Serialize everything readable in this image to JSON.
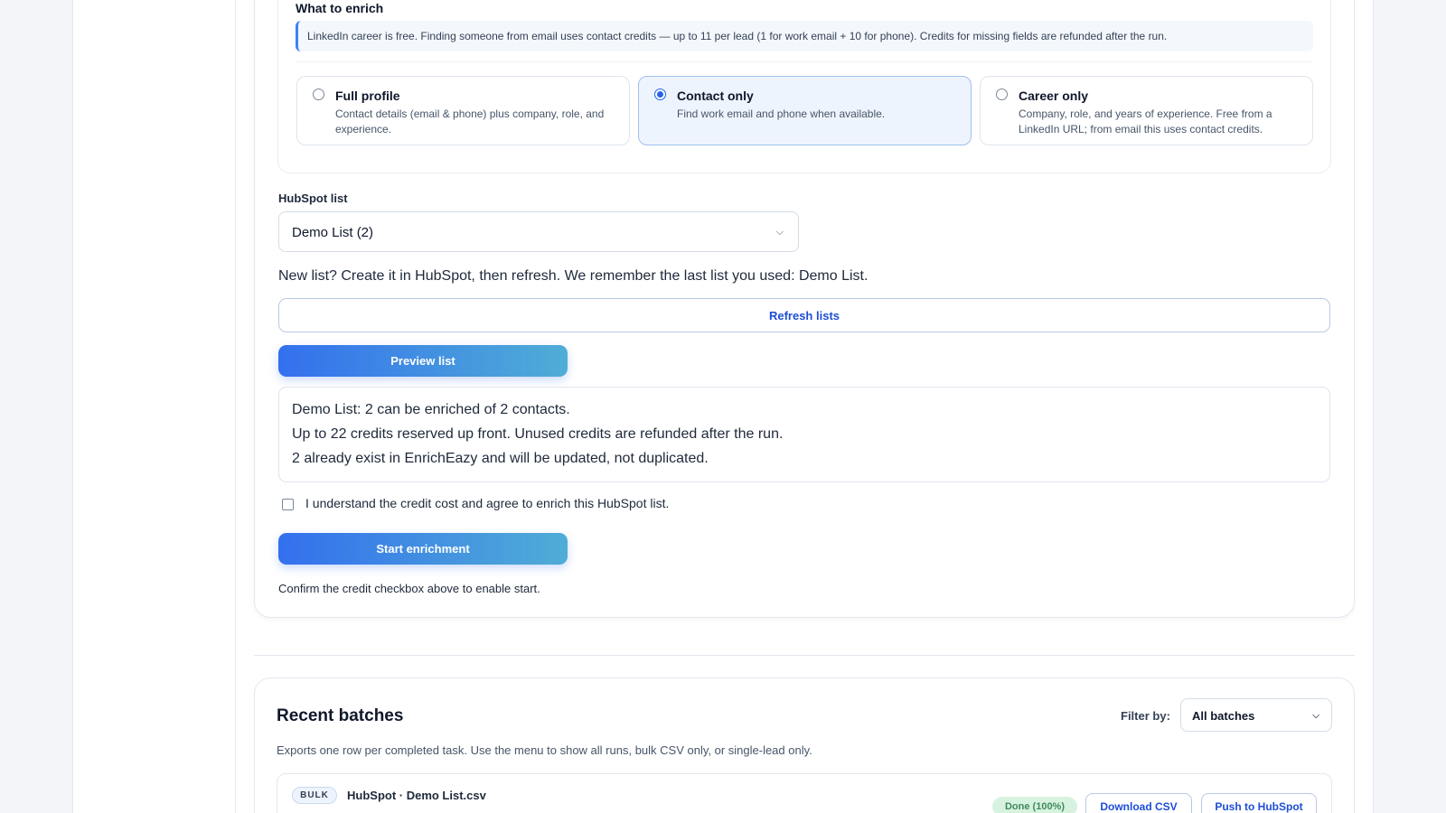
{
  "enrich": {
    "section_title": "What to enrich",
    "info": "LinkedIn career is free. Finding someone from email uses contact credits — up to 11 per lead (1 for work email + 10 for phone). Credits for missing fields are refunded after the run.",
    "options": [
      {
        "title": "Full profile",
        "description": "Contact details (email & phone) plus company, role, and experience.",
        "selected": false
      },
      {
        "title": "Contact only",
        "description": "Find work email and phone when available.",
        "selected": true
      },
      {
        "title": "Career only",
        "description": "Company, role, and years of experience. Free from a LinkedIn URL; from email this uses contact credits.",
        "selected": false
      }
    ]
  },
  "hubspot": {
    "label": "HubSpot list",
    "selected_list": "Demo List (2)",
    "hint": "New list? Create it in HubSpot, then refresh. We remember the last list you used: Demo List.",
    "refresh_label": "Refresh lists",
    "preview_label": "Preview list",
    "preview_lines": [
      "Demo List: 2 can be enriched of 2 contacts.",
      "Up to 22 credits reserved up front. Unused credits are refunded after the run.",
      "2 already exist in EnrichEazy and will be updated, not duplicated."
    ],
    "consent_label": "I understand the credit cost and agree to enrich this HubSpot list.",
    "consent_checked": false,
    "start_label": "Start enrichment",
    "confirm_note": "Confirm the credit checkbox above to enable start."
  },
  "batches": {
    "title": "Recent batches",
    "filter_label": "Filter by:",
    "filter_value": "All batches",
    "description": "Exports one row per completed task. Use the menu to show all runs, bulk CSV only, or single-lead only.",
    "rows": [
      {
        "tag": "BULK",
        "name": "HubSpot · Demo List.csv",
        "status": "Done (100%)",
        "download_label": "Download CSV",
        "push_label": "Push to HubSpot"
      }
    ]
  },
  "icons": {
    "select_chevron": "chevron-down-icon"
  },
  "colors": {
    "accent": "#2563eb",
    "gradient_start": "#3470ee",
    "gradient_end": "#4fadd6",
    "success_bg": "#d8f2e0",
    "success_text": "#3f8b5d"
  }
}
